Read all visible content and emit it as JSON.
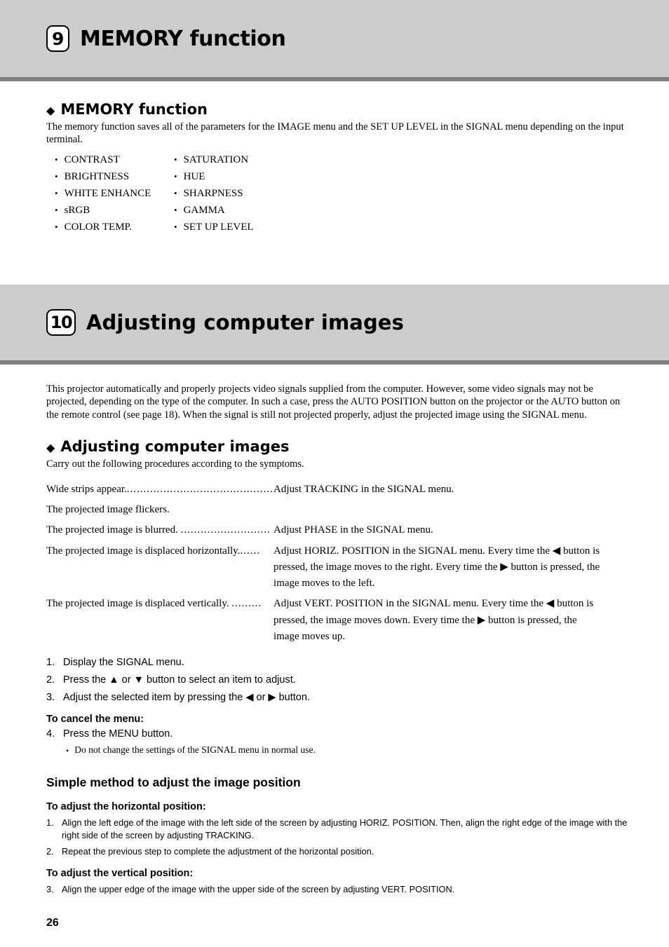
{
  "page": {
    "number": "26",
    "band_color": "#cccccc",
    "rule_color": "#808080"
  },
  "chapter_9": {
    "badge": "9",
    "title": "MEMORY function",
    "section": {
      "heading": "MEMORY function",
      "diamond": "◆",
      "intro": "The memory function saves all of the parameters for the IMAGE menu and the SET UP LEVEL in the SIGNAL menu depending on the input terminal.",
      "bullet": "•",
      "parameters": [
        {
          "col1": "CONTRAST",
          "col2": "SATURATION"
        },
        {
          "col1": "BRIGHTNESS",
          "col2": "HUE"
        },
        {
          "col1": "WHITE ENHANCE",
          "col2": "SHARPNESS"
        },
        {
          "col1": "sRGB",
          "col2": "GAMMA"
        },
        {
          "col1": "COLOR TEMP.",
          "col2": "SET UP LEVEL"
        }
      ]
    }
  },
  "chapter_10": {
    "badge": "10",
    "title": "Adjusting computer images",
    "intro": "This projector automatically and properly projects video signals supplied from the computer. However, some video signals may not be projected, depending on the type of the computer. In such a case, press the AUTO POSITION button on the projector or the AUTO button on the remote control (see page 18). When the signal is still not projected properly, adjust the projected image using the SIGNAL menu.",
    "section": {
      "heading": "Adjusting computer images",
      "diamond": "◆",
      "lead": "Carry out the following procedures according to the symptoms.",
      "symptoms": [
        {
          "symptom": "Wide strips appear.",
          "leader": "................................................",
          "remedy": "Adjust TRACKING in the SIGNAL menu.",
          "continued": []
        },
        {
          "symptom": "The projected image flickers.",
          "leader": "",
          "remedy": "",
          "continued": []
        },
        {
          "symptom": "The projected image is blurred. ",
          "leader": "...........................",
          "remedy": "Adjust PHASE in the SIGNAL menu.",
          "continued": []
        },
        {
          "symptom": "The projected image is displaced horizontally.",
          "leader": "......",
          "remedy": "Adjust HORIZ. POSITION in the SIGNAL menu. Every time the ◀ button is",
          "continued": [
            "pressed, the image moves to the right. Every time the ▶ button is pressed, the",
            "image moves to the left."
          ]
        },
        {
          "symptom": "The projected image is displaced vertically. ",
          "leader": ".........",
          "remedy": "Adjust VERT. POSITION in the SIGNAL menu. Every time the ◀ button is",
          "continued": [
            "pressed, the image moves down. Every time the ▶ button is pressed, the",
            "image moves up."
          ]
        }
      ],
      "steps": [
        {
          "num": "1.",
          "text": "Display the SIGNAL menu."
        },
        {
          "num": "2.",
          "text": "Press the ▲ or ▼ button to select an item to adjust."
        },
        {
          "num": "3.",
          "text": "Adjust the selected item by pressing the ◀ or ▶ button."
        }
      ],
      "cancel_heading": "To cancel the menu:",
      "cancel_step": {
        "num": "4.",
        "text": "Press the MENU button."
      },
      "note_bullet": "•",
      "note": "Do not change the settings of the SIGNAL menu in normal use."
    },
    "simple_method": {
      "heading": "Simple method to adjust the image position",
      "horizontal_heading": "To adjust the horizontal position:",
      "horizontal_steps": [
        {
          "num": "1.",
          "text": "Align the left edge of the image with the left side of the screen by adjusting HORIZ. POSITION. Then, align the right edge of the image with the right side of the screen by adjusting TRACKING."
        },
        {
          "num": "2.",
          "text": "Repeat the previous step to complete the adjustment of the horizontal position."
        }
      ],
      "vertical_heading": "To adjust the vertical position:",
      "vertical_steps": [
        {
          "num": "3.",
          "text": "Align the upper edge of the image with the upper side of the screen by adjusting VERT. POSITION."
        }
      ]
    }
  }
}
